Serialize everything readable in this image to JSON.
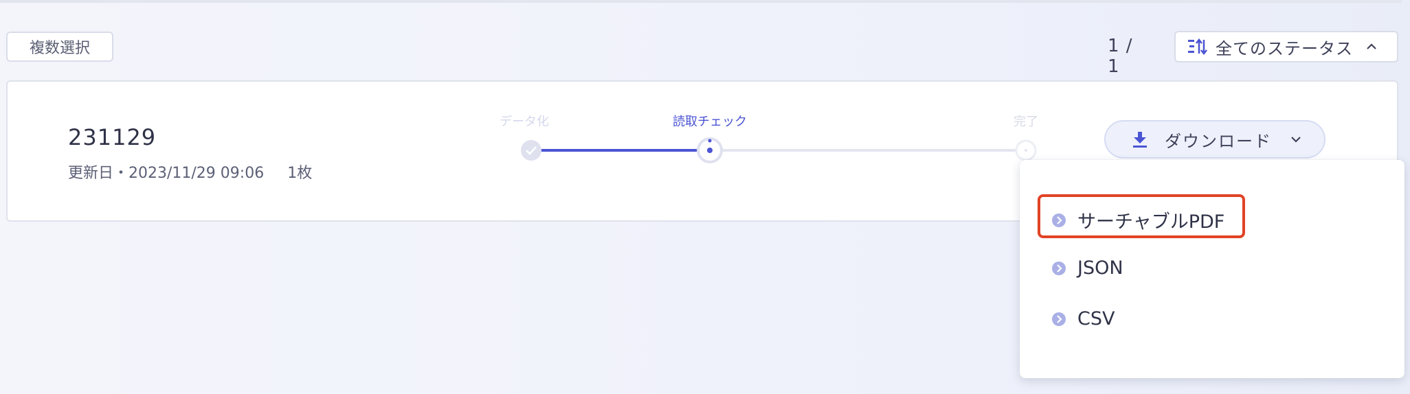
{
  "toolbar": {
    "multi_select_label": "複数選択",
    "page_count": "1 / 1",
    "status_filter_label": "全てのステータス"
  },
  "document": {
    "title": "231129",
    "updated": "更新日・2023/11/29 09:06",
    "pages": "1枚",
    "steps": [
      {
        "label": "データ化",
        "state": "done"
      },
      {
        "label": "読取チェック",
        "state": "current"
      },
      {
        "label": "完了",
        "state": "future"
      }
    ]
  },
  "download": {
    "button_label": "ダウンロード",
    "options": [
      "サーチャブルPDF",
      "JSON",
      "CSV"
    ],
    "highlighted_option": "サーチャブルPDF"
  },
  "colors": {
    "accent": "#4b54d3",
    "highlight_border": "#e04325",
    "step_inactive": "#dfe1ef"
  }
}
